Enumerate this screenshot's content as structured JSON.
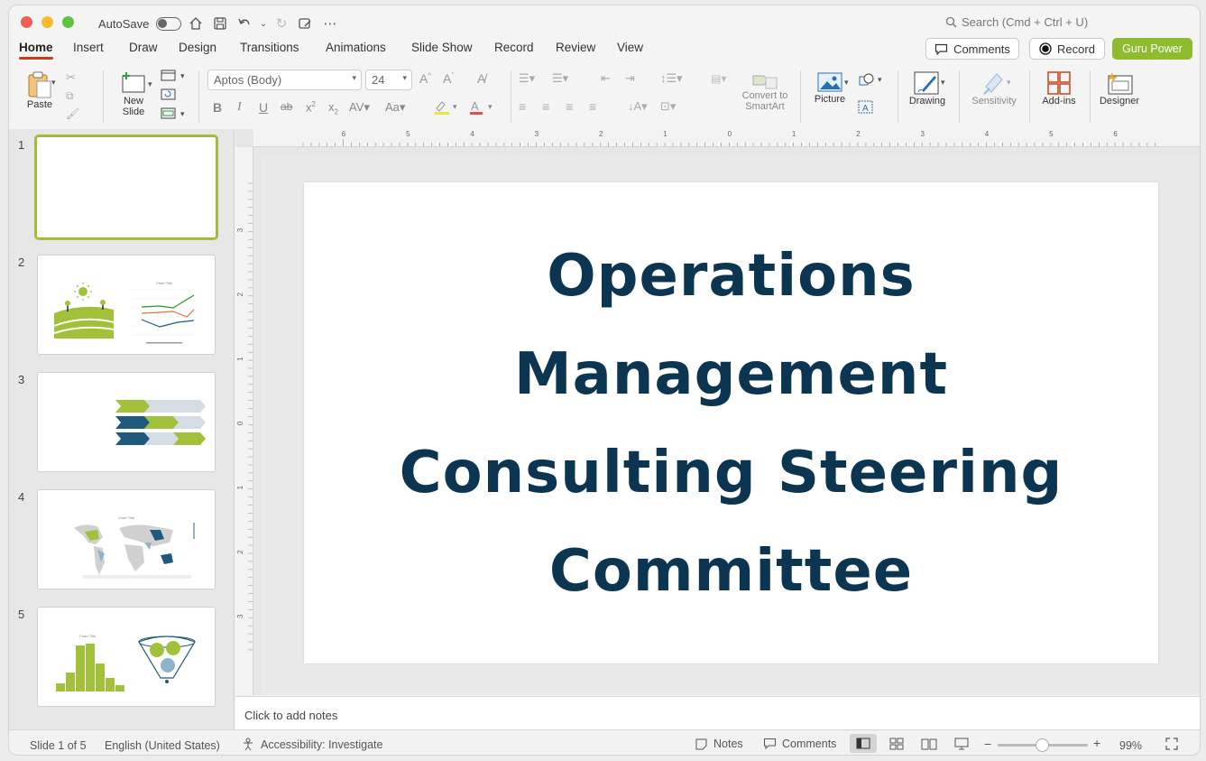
{
  "titlebar": {
    "autosave_label": "AutoSave",
    "search_placeholder": "Search (Cmd + Ctrl + U)"
  },
  "tabs": [
    "Home",
    "Insert",
    "Draw",
    "Design",
    "Transitions",
    "Animations",
    "Slide Show",
    "Record",
    "Review",
    "View"
  ],
  "header_buttons": {
    "comments": "Comments",
    "record": "Record",
    "guru": "Guru Power"
  },
  "ribbon": {
    "paste": "Paste",
    "new_slide": "New\nSlide",
    "font_name": "Aptos (Body)",
    "font_size": "24",
    "convert_smartart": "Convert to\nSmartArt",
    "picture": "Picture",
    "drawing": "Drawing",
    "sensitivity": "Sensitivity",
    "addins": "Add-ins",
    "designer": "Designer"
  },
  "ruler": {
    "h_ticks": [
      "6",
      "5",
      "4",
      "3",
      "2",
      "1",
      "0",
      "1",
      "2",
      "3",
      "4",
      "5",
      "6"
    ],
    "v_ticks": [
      "3",
      "2",
      "1",
      "0",
      "1",
      "2",
      "3"
    ]
  },
  "slides": {
    "numbers": [
      "1",
      "2",
      "3",
      "4",
      "5"
    ],
    "selected_index": 0,
    "thumb_chart_titles": {
      "s2": "Chart Title",
      "s4": "Chart Title",
      "s5": "Chart Title"
    }
  },
  "slide": {
    "title_lines": [
      "Operations",
      "Management",
      "Consulting Steering",
      "Committee"
    ]
  },
  "notes_placeholder": "Click to add notes",
  "status": {
    "slide_info": "Slide 1 of 5",
    "language": "English (United States)",
    "accessibility": "Accessibility: Investigate",
    "notes": "Notes",
    "comments": "Comments",
    "zoom": "99%"
  },
  "colors": {
    "accent": "#c43e1c",
    "title": "#0b3550",
    "green": "#a1c13a",
    "navy": "#1f5a7e",
    "guru": "#8fbb2f"
  }
}
